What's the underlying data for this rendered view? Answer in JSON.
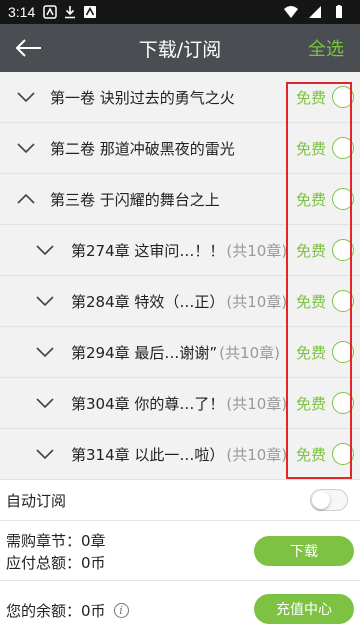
{
  "status_bar": {
    "time": "3:14"
  },
  "app_bar": {
    "title": "下载/订阅",
    "select_all": "全选"
  },
  "volumes": [
    {
      "label": "第一卷 诀别过去的勇气之火",
      "price": "免费",
      "expanded": false
    },
    {
      "label": "第二卷 那道冲破黑夜的雷光",
      "price": "免费",
      "expanded": false
    },
    {
      "label": "第三卷 于闪耀的舞台之上",
      "price": "免费",
      "expanded": true
    }
  ],
  "chapters": [
    {
      "label": "第274章 这审问…！！",
      "count": "(共10章)",
      "price": "免费"
    },
    {
      "label": "第284章 特效（…正）",
      "count": "(共10章)",
      "price": "免费"
    },
    {
      "label": "第294章 最后…谢谢”",
      "count": "(共10章)",
      "price": "免费"
    },
    {
      "label": "第304章 你的尊…了！",
      "count": "(共10章)",
      "price": "免费"
    },
    {
      "label": "第314章 以此一…啦）",
      "count": "(共10章)",
      "price": "免费"
    }
  ],
  "auto_subscribe": {
    "label": "自动订阅",
    "enabled": false
  },
  "summary": {
    "chapters_line": "需购章节：0章",
    "total_line": "应付总额：0币",
    "download_button": "下载"
  },
  "balance": {
    "line": "您的余额：0币",
    "recharge_button": "充值中心"
  },
  "colors": {
    "accent": "#7dc242",
    "appbar": "#4a4d51",
    "highlight": "#e0262a"
  }
}
